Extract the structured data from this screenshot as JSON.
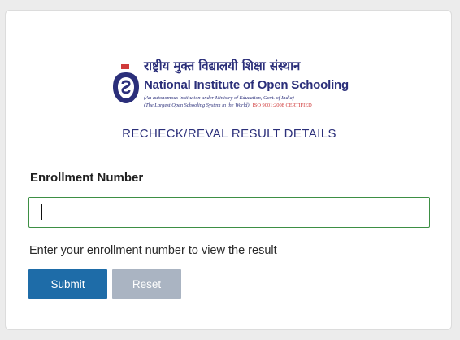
{
  "logo": {
    "hindi_name": "राष्ट्रीय मुक्त विद्यालयी शिक्षा संस्थान",
    "english_name_part1": "National Institute of ",
    "english_name_part2": "Open Schooling",
    "subtitle1": "(An autonomous institution under Ministry of Education, Govt. of India)",
    "subtitle2": "(The Largest Open Schooling System in the World)",
    "iso": "ISO 9001:2008 CERTIFIED",
    "emblem_icon": "nios-emblem-icon",
    "brand_color": "#2b2f7a",
    "accent_color": "#d03a3a"
  },
  "page": {
    "title": "RECHECK/REVAL RESULT DETAILS"
  },
  "form": {
    "enrollment_label": "Enrollment Number",
    "enrollment_value": "",
    "enrollment_placeholder": "",
    "help_text": "Enter your enrollment number to view the result",
    "submit_label": "Submit",
    "reset_label": "Reset",
    "input_border_color": "#3d8f44",
    "submit_color": "#1e6ca8",
    "reset_color": "#aab4c2"
  }
}
